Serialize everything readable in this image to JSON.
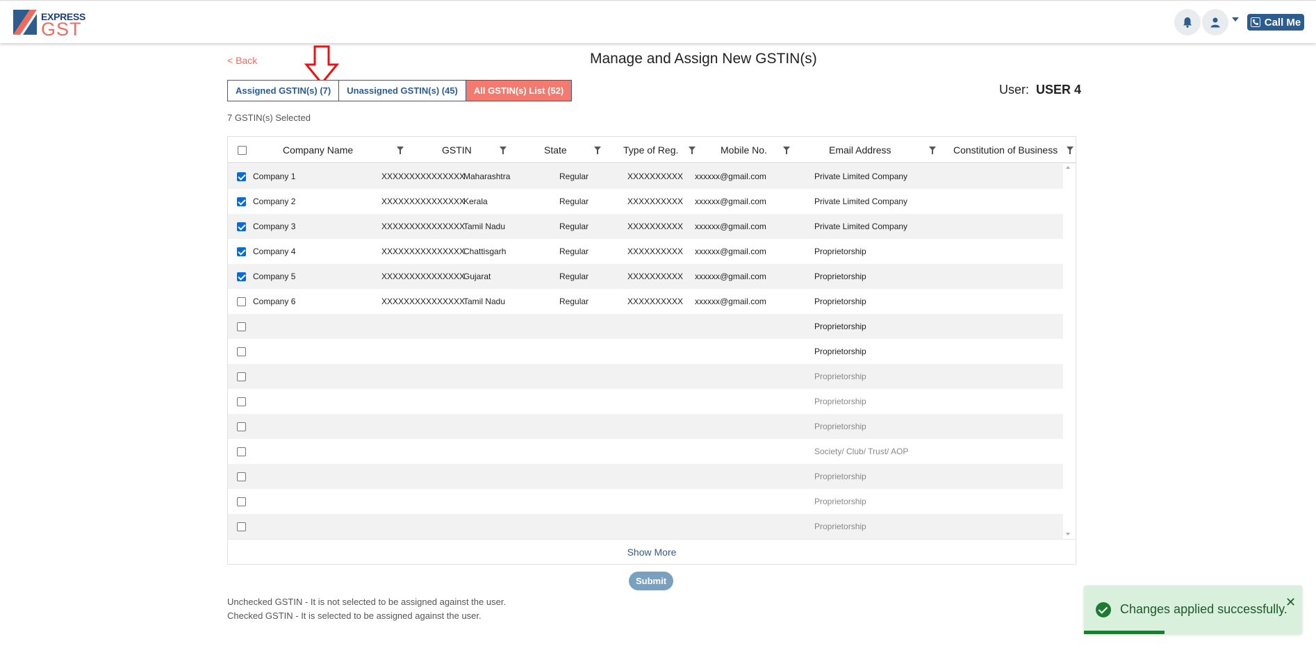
{
  "header": {
    "logo_top": "EXPRESS",
    "logo_bottom": "GST",
    "call_label": "Call Me"
  },
  "page": {
    "back_label": "< Back",
    "title": "Manage and Assign New GSTIN(s)",
    "user_prefix": "User:",
    "user_name": "USER 4",
    "selected_text": "7 GSTIN(s) Selected"
  },
  "tabs": [
    {
      "label": "Assigned GSTIN(s) (7)",
      "active": false
    },
    {
      "label": "Unassigned GSTIN(s) (45)",
      "active": false
    },
    {
      "label": "All GSTIN(s) List (52)",
      "active": true
    }
  ],
  "table": {
    "columns": [
      "Company Name",
      "GSTIN",
      "State",
      "Type of Reg.",
      "Mobile No.",
      "Email Address",
      "Constitution of Business"
    ],
    "rows": [
      {
        "checked": true,
        "company": "Company 1",
        "gstin": "XXXXXXXXXXXXXXX",
        "state": "Maharashtra",
        "reg": "Regular",
        "mobile": "XXXXXXXXXX",
        "email": "xxxxxx@gmail.com",
        "constitution": "Private Limited Company",
        "faded": false
      },
      {
        "checked": true,
        "company": "Company 2",
        "gstin": "XXXXXXXXXXXXXXX",
        "state": "Kerala",
        "reg": "Regular",
        "mobile": "XXXXXXXXXX",
        "email": "xxxxxx@gmail.com",
        "constitution": "Private Limited Company",
        "faded": false
      },
      {
        "checked": true,
        "company": "Company 3",
        "gstin": "XXXXXXXXXXXXXXX",
        "state": "Tamil Nadu",
        "reg": "Regular",
        "mobile": "XXXXXXXXXX",
        "email": "xxxxxx@gmail.com",
        "constitution": "Private Limited Company",
        "faded": false
      },
      {
        "checked": true,
        "company": "Company 4",
        "gstin": "XXXXXXXXXXXXXXX",
        "state": "Chattisgarh",
        "reg": "Regular",
        "mobile": "XXXXXXXXXX",
        "email": "xxxxxx@gmail.com",
        "constitution": "Proprietorship",
        "faded": false
      },
      {
        "checked": true,
        "company": "Company 5",
        "gstin": "XXXXXXXXXXXXXXX",
        "state": "Gujarat",
        "reg": "Regular",
        "mobile": "XXXXXXXXXX",
        "email": "xxxxxx@gmail.com",
        "constitution": "Proprietorship",
        "faded": false
      },
      {
        "checked": false,
        "company": "Company 6",
        "gstin": "XXXXXXXXXXXXXXX",
        "state": "Tamil Nadu",
        "reg": "Regular",
        "mobile": "XXXXXXXXXX",
        "email": "xxxxxx@gmail.com",
        "constitution": "Proprietorship",
        "faded": false
      },
      {
        "checked": false,
        "company": "",
        "gstin": "",
        "state": "",
        "reg": "",
        "mobile": "",
        "email": "",
        "constitution": "Proprietorship",
        "faded": false
      },
      {
        "checked": false,
        "company": "",
        "gstin": "",
        "state": "",
        "reg": "",
        "mobile": "",
        "email": "",
        "constitution": "Proprietorship",
        "faded": false
      },
      {
        "checked": false,
        "company": "",
        "gstin": "",
        "state": "",
        "reg": "",
        "mobile": "",
        "email": "",
        "constitution": "Proprietorship",
        "faded": true
      },
      {
        "checked": false,
        "company": "",
        "gstin": "",
        "state": "",
        "reg": "",
        "mobile": "",
        "email": "",
        "constitution": "Proprietorship",
        "faded": true
      },
      {
        "checked": false,
        "company": "",
        "gstin": "",
        "state": "",
        "reg": "",
        "mobile": "",
        "email": "",
        "constitution": "Proprietorship",
        "faded": true
      },
      {
        "checked": false,
        "company": "",
        "gstin": "",
        "state": "",
        "reg": "",
        "mobile": "",
        "email": "",
        "constitution": "Society/ Club/ Trust/ AOP",
        "faded": true
      },
      {
        "checked": false,
        "company": "",
        "gstin": "",
        "state": "",
        "reg": "",
        "mobile": "",
        "email": "",
        "constitution": "Proprietorship",
        "faded": true
      },
      {
        "checked": false,
        "company": "",
        "gstin": "",
        "state": "",
        "reg": "",
        "mobile": "",
        "email": "",
        "constitution": "Proprietorship",
        "faded": true
      },
      {
        "checked": false,
        "company": "",
        "gstin": "",
        "state": "",
        "reg": "",
        "mobile": "",
        "email": "",
        "constitution": "Proprietorship",
        "faded": true
      }
    ],
    "show_more_label": "Show More"
  },
  "submit_label": "Submit",
  "notes": [
    "Unchecked GSTIN - It is not selected to be assigned against the user.",
    "Checked GSTIN - It is selected to be assigned against the user."
  ],
  "toast": {
    "message": "Changes applied successfully.",
    "close_symbol": "✕",
    "progress": 0.37
  },
  "colors": {
    "accent": "#f06b5f",
    "primary": "#2c5d8e",
    "checkbox": "#0b6bd3",
    "success": "#1e7b34"
  },
  "icons": {
    "bell": "bell-icon",
    "user": "user-icon",
    "phone": "phone-icon",
    "filter": "filter-icon",
    "arrow": "down-arrow-annotation-icon",
    "check": "check-circle-icon"
  }
}
